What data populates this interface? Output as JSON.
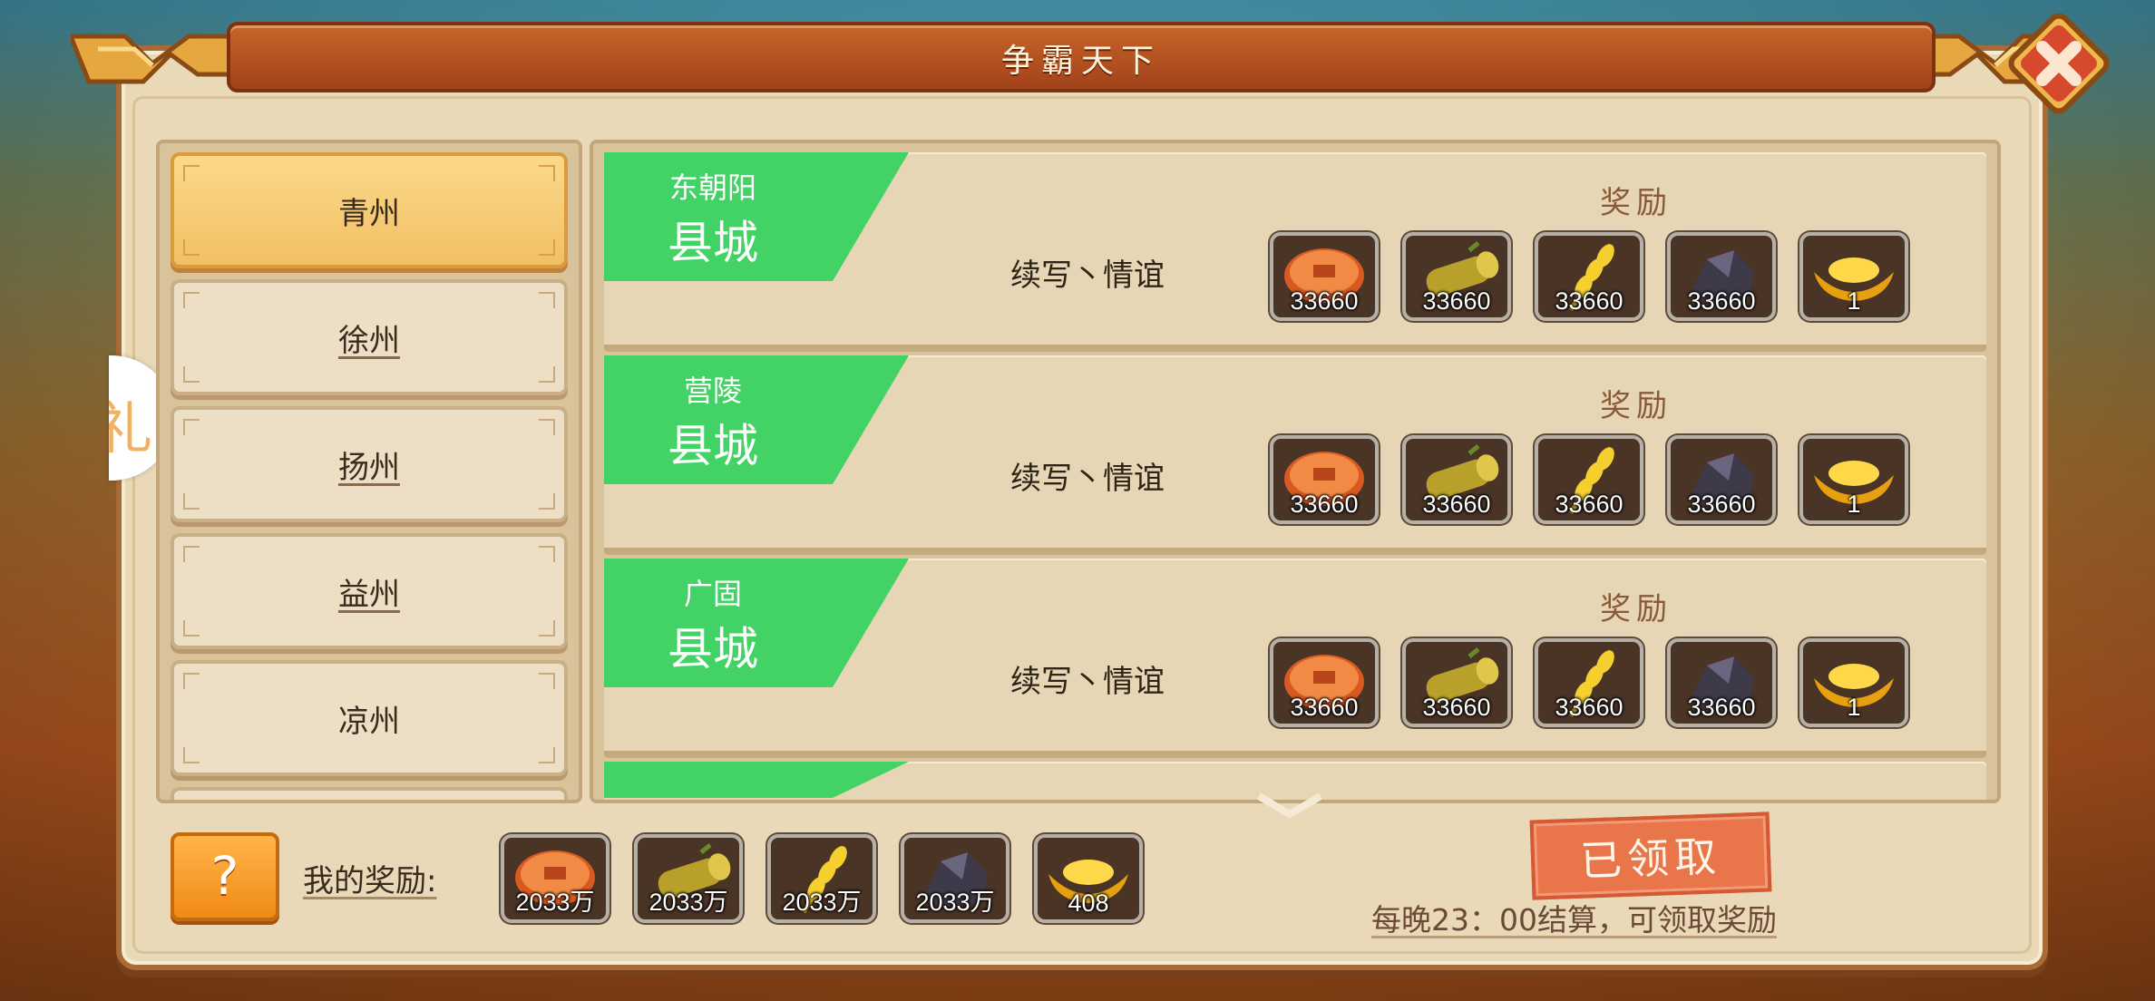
{
  "title": "争霸天下",
  "cities": [
    {
      "label": "青州",
      "active": true
    },
    {
      "label": "徐州",
      "active": false
    },
    {
      "label": "扬州",
      "active": false
    },
    {
      "label": "益州",
      "active": false
    },
    {
      "label": "凉州",
      "active": false
    }
  ],
  "side_tab_char": "礼",
  "rows": [
    {
      "place": "东朝阳",
      "type": "县城",
      "owner": "续写丶情谊",
      "reward_label": "奖励",
      "rewards": [
        {
          "icon": "copper-coin-icon",
          "count": "33660"
        },
        {
          "icon": "wood-log-icon",
          "count": "33660"
        },
        {
          "icon": "wheat-icon",
          "count": "33660"
        },
        {
          "icon": "iron-ore-icon",
          "count": "33660"
        },
        {
          "icon": "gold-ingot-icon",
          "count": "1"
        }
      ]
    },
    {
      "place": "营陵",
      "type": "县城",
      "owner": "续写丶情谊",
      "reward_label": "奖励",
      "rewards": [
        {
          "icon": "copper-coin-icon",
          "count": "33660"
        },
        {
          "icon": "wood-log-icon",
          "count": "33660"
        },
        {
          "icon": "wheat-icon",
          "count": "33660"
        },
        {
          "icon": "iron-ore-icon",
          "count": "33660"
        },
        {
          "icon": "gold-ingot-icon",
          "count": "1"
        }
      ]
    },
    {
      "place": "广固",
      "type": "县城",
      "owner": "续写丶情谊",
      "reward_label": "奖励",
      "rewards": [
        {
          "icon": "copper-coin-icon",
          "count": "33660"
        },
        {
          "icon": "wood-log-icon",
          "count": "33660"
        },
        {
          "icon": "wheat-icon",
          "count": "33660"
        },
        {
          "icon": "iron-ore-icon",
          "count": "33660"
        },
        {
          "icon": "gold-ingot-icon",
          "count": "1"
        }
      ]
    }
  ],
  "bottom": {
    "help_label": "?",
    "my_reward_label": "我的奖励:",
    "my_rewards": [
      {
        "icon": "copper-coin-icon",
        "count": "2033万"
      },
      {
        "icon": "wood-log-icon",
        "count": "2033万"
      },
      {
        "icon": "wheat-icon",
        "count": "2033万"
      },
      {
        "icon": "iron-ore-icon",
        "count": "2033万"
      },
      {
        "icon": "gold-ingot-icon",
        "count": "408"
      }
    ],
    "claimed_label": "已领取",
    "settle_note": "每晚23：00结算，可领取奖励"
  },
  "colors": {
    "accent_green": "#43d266",
    "title_bar": "#b24f1f",
    "stamp": "#e9754a"
  }
}
